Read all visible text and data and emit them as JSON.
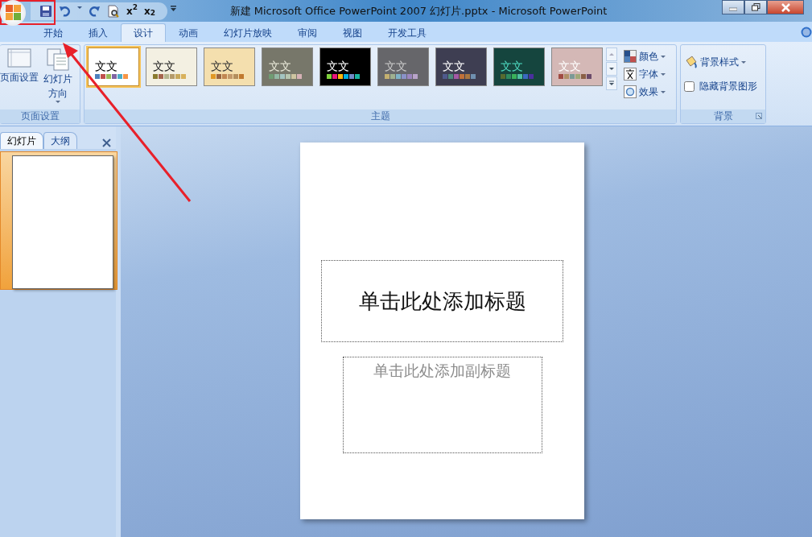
{
  "window": {
    "title": "新建 Microsoft Office PowerPoint 2007 幻灯片.pptx - Microsoft PowerPoint"
  },
  "quick_access": [
    {
      "kind": "save"
    },
    {
      "kind": "undo"
    },
    {
      "kind": "caret"
    },
    {
      "kind": "redo"
    },
    {
      "kind": "preview"
    },
    {
      "kind": "text",
      "label": "x$^{2}$"
    },
    {
      "kind": "text",
      "label": "x$_{2}$"
    },
    {
      "kind": "customize"
    }
  ],
  "ribbon_tabs": [
    {
      "label": "开始",
      "selected": false
    },
    {
      "label": "插入",
      "selected": false
    },
    {
      "label": "设计",
      "selected": true
    },
    {
      "label": "动画",
      "selected": false
    },
    {
      "label": "幻灯片放映",
      "selected": false
    },
    {
      "label": "审阅",
      "selected": false
    },
    {
      "label": "视图",
      "selected": false
    },
    {
      "label": "开发工具",
      "selected": false
    }
  ],
  "page_setup_group": {
    "label": "页面设置",
    "buttons": [
      {
        "label": "页面设置",
        "kind": "page",
        "dropdown": false
      },
      {
        "label": "幻灯片方向",
        "kind": "orientation",
        "dropdown": true
      }
    ]
  },
  "themes_group": {
    "label": "主题",
    "themes": [
      {
        "label": "文文",
        "selected": true
      },
      {
        "label": "文文",
        "selected": false
      },
      {
        "label": "文文",
        "selected": false
      },
      {
        "label": "文文",
        "selected": false
      },
      {
        "label": "文文",
        "selected": false
      },
      {
        "label": "文文",
        "selected": false
      },
      {
        "label": "文文",
        "selected": false
      },
      {
        "label": "文文",
        "selected": false
      },
      {
        "label": "文文",
        "selected": false
      }
    ],
    "options": [
      {
        "label": "颜色",
        "kind": "colors"
      },
      {
        "label": "字体",
        "kind": "fonts"
      },
      {
        "label": "效果",
        "kind": "effects"
      }
    ]
  },
  "background_group": {
    "label": "背景",
    "style_button": "背景样式",
    "hide_graphics": {
      "label": "隐藏背景图形",
      "checked": false
    }
  },
  "pane_tabs": [
    {
      "label": "幻灯片",
      "selected": true
    },
    {
      "label": "大纲",
      "selected": false
    }
  ],
  "thumbnails": [
    {
      "selected": true
    }
  ],
  "slide": {
    "title_placeholder": "单击此处添加标题",
    "subtitle_placeholder": "单击此处添加副标题"
  }
}
